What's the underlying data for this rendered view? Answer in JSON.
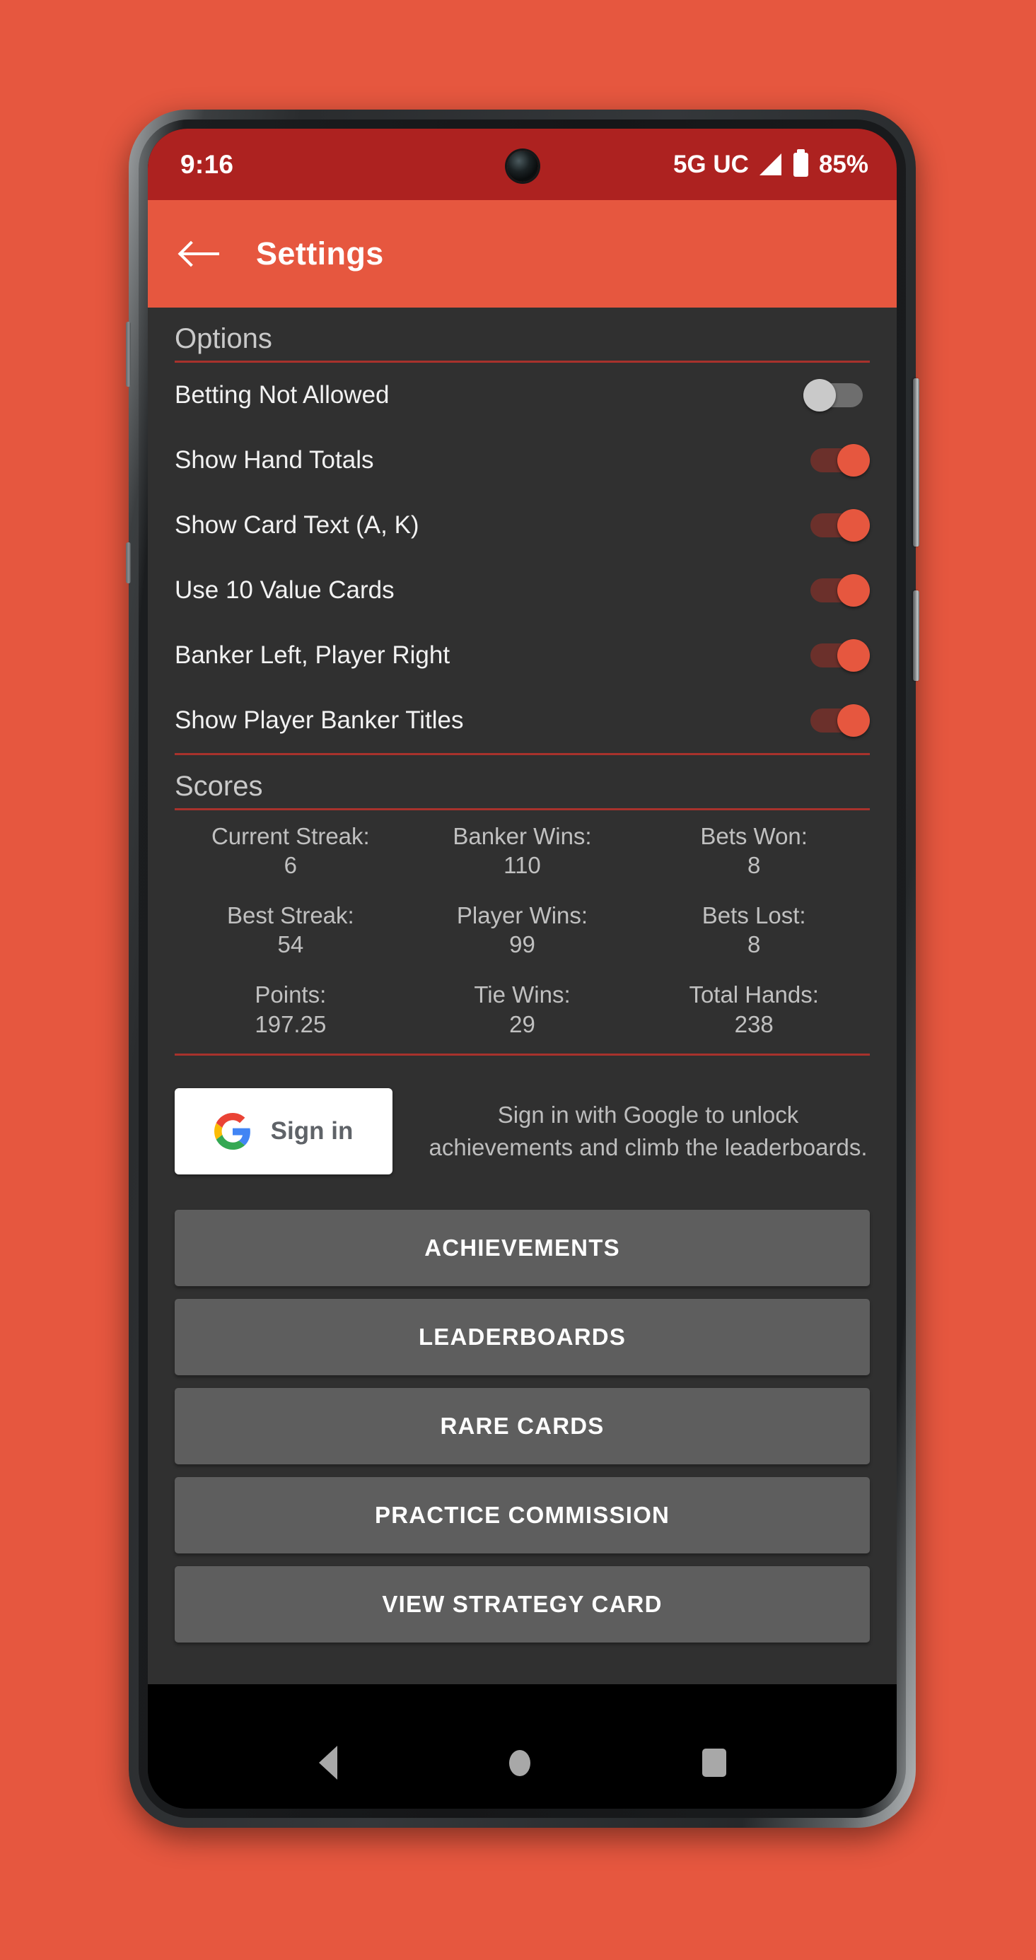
{
  "theme": {
    "wallpaper": "#e6573f",
    "status_bar_bg": "#ad2220",
    "app_bar_bg": "#e6573f",
    "content_bg": "#303030",
    "accent": "#e6573f",
    "divider": "#a8322c",
    "button_bg": "#5e5e5e"
  },
  "status_bar": {
    "time": "9:16",
    "network": "5G UC",
    "battery_percent": "85%",
    "signal_icon": "signal-bars-icon",
    "battery_icon": "battery-icon",
    "camera_icon": "front-camera-icon"
  },
  "app_bar": {
    "back_icon": "back-arrow-icon",
    "title": "Settings"
  },
  "options": {
    "header": "Options",
    "items": [
      {
        "label": "Betting Not Allowed",
        "state": "off"
      },
      {
        "label": "Show Hand Totals",
        "state": "on"
      },
      {
        "label": "Show Card Text (A, K)",
        "state": "on"
      },
      {
        "label": "Use 10 Value Cards",
        "state": "on"
      },
      {
        "label": "Banker Left, Player Right",
        "state": "on"
      },
      {
        "label": "Show Player Banker Titles",
        "state": "on"
      }
    ]
  },
  "scores": {
    "header": "Scores",
    "cells": [
      {
        "label": "Current Streak:",
        "value": "6"
      },
      {
        "label": "Banker Wins:",
        "value": "110"
      },
      {
        "label": "Bets Won:",
        "value": "8"
      },
      {
        "label": "Best Streak:",
        "value": "54"
      },
      {
        "label": "Player Wins:",
        "value": "99"
      },
      {
        "label": "Bets Lost:",
        "value": "8"
      },
      {
        "label": "Points:",
        "value": "197.25"
      },
      {
        "label": "Tie Wins:",
        "value": "29"
      },
      {
        "label": "Total Hands:",
        "value": "238"
      }
    ]
  },
  "signin": {
    "button_label": "Sign in",
    "google_icon": "google-g-icon",
    "description": "Sign in with Google to unlock achievements and climb the leaderboards."
  },
  "actions": [
    {
      "label": "ACHIEVEMENTS"
    },
    {
      "label": "LEADERBOARDS"
    },
    {
      "label": "RARE CARDS"
    },
    {
      "label": "PRACTICE COMMISSION"
    },
    {
      "label": "VIEW STRATEGY CARD"
    }
  ],
  "nav_bar": {
    "back_icon": "nav-back-triangle-icon",
    "home_icon": "nav-home-circle-icon",
    "recents_icon": "nav-recents-square-icon"
  }
}
